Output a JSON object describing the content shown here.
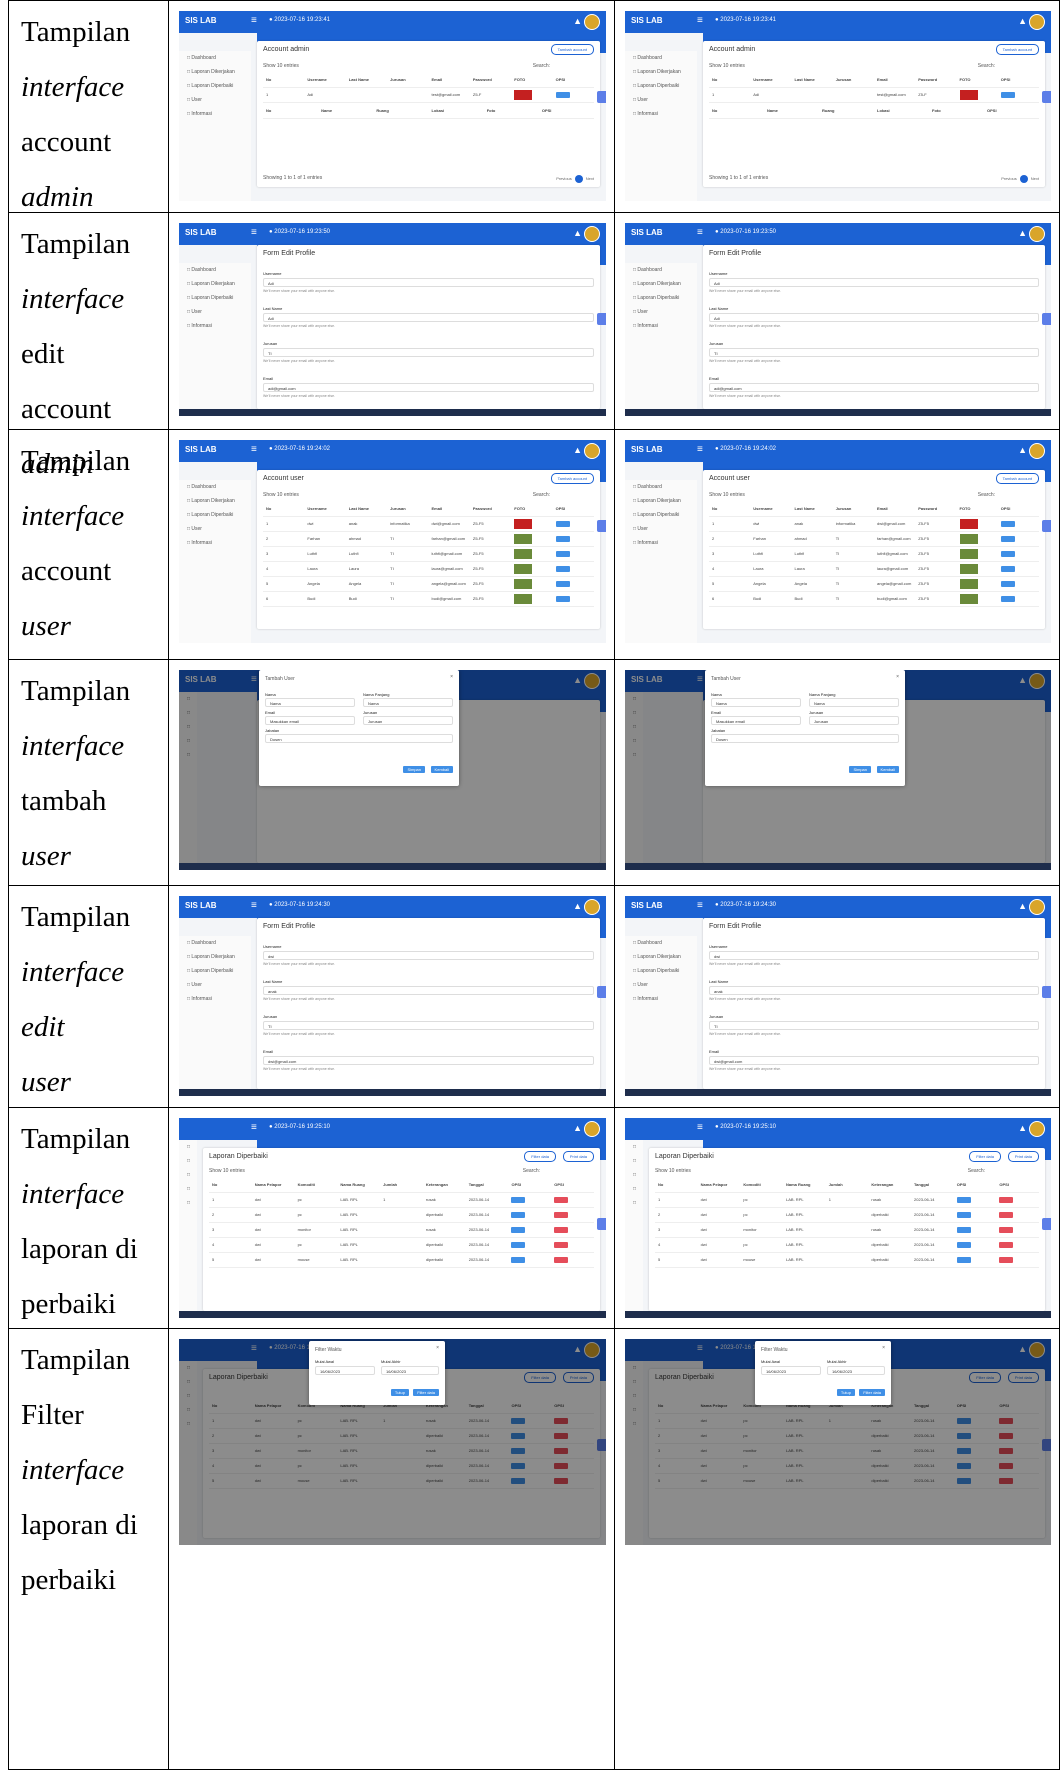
{
  "rows": [
    {
      "label_lines": [
        {
          "text": "Tampilan",
          "italic": false
        },
        {
          "text": "interface",
          "italic": true
        },
        {
          "text": "account",
          "italic": false
        },
        {
          "text": "admin",
          "italic": true
        }
      ],
      "screen": {
        "kind": "table",
        "brand": "SIS LAB",
        "datetime": "2023-07-16 19:23:41",
        "sidebar": [
          "Dashboard",
          "Laporan Dikerjakan",
          "Laporan Diperbaiki",
          "User",
          "Informasi"
        ],
        "title": "Account admin",
        "button": "Tambah account",
        "show": "Show  10  entries",
        "search": "Search:",
        "headers": [
          "No",
          "Username",
          "Last Name",
          "Jurusan",
          "Email",
          "Password",
          "FOTO",
          "OPSI"
        ],
        "rows": [
          [
            "1",
            "Adi",
            "",
            "",
            "test@gmail.com",
            "Z5-F",
            "",
            ""
          ]
        ],
        "footer": [
          "No",
          "Name",
          "Ruang",
          "Lokasi",
          "Foto",
          "OPSI"
        ],
        "info": "Showing 1 to 1 of 1 entries",
        "prev": "Previous",
        "page": "1",
        "next": "Next"
      }
    },
    {
      "label_lines": [
        {
          "text": "Tampilan",
          "italic": false
        },
        {
          "text": "interface",
          "italic": true
        },
        {
          "text": "edit",
          "italic": false
        },
        {
          "text": "account",
          "italic": false
        },
        {
          "text": "admin",
          "italic": true
        }
      ],
      "screen": {
        "kind": "form",
        "brand": "SIS LAB",
        "datetime": "2023-07-16 19:23:50",
        "sidebar": [
          "Dashboard",
          "Laporan Dikerjakan",
          "Laporan Diperbaiki",
          "User",
          "Informasi"
        ],
        "title": "Form Edit Profile",
        "fields": [
          {
            "label": "Username",
            "value": "Adi",
            "help": "We'll never share your email with anyone else."
          },
          {
            "label": "Last Name",
            "value": "Adi",
            "help": "We'll never share your email with anyone else."
          },
          {
            "label": "Jurusan",
            "value": "TI",
            "help": "We'll never share your email with anyone else."
          },
          {
            "label": "Email",
            "value": "adi@gmail.com",
            "help": "We'll never share your email with anyone else."
          }
        ]
      }
    },
    {
      "label_lines": [
        {
          "text": "Tampilan",
          "italic": false
        },
        {
          "text": "interface",
          "italic": true
        },
        {
          "text": "account",
          "italic": false
        },
        {
          "text": "user",
          "italic": true
        }
      ],
      "screen": {
        "kind": "table",
        "brand": "SIS LAB",
        "datetime": "2023-07-16 19:24:02",
        "sidebar": [
          "Dashboard",
          "Laporan Dikerjakan",
          "Laporan Diperbaiki",
          "User",
          "Informasi"
        ],
        "title": "Account user",
        "button": "Tambah account",
        "show": "Show  10  entries",
        "search": "Search:",
        "headers": [
          "No",
          "Username",
          "Last Name",
          "Jurusan",
          "Email",
          "Password",
          "FOTO",
          "OPSI"
        ],
        "rows": [
          [
            "1",
            "dwi",
            "anak",
            "informatika",
            "dwi@gmail.com",
            "Z5-F5",
            "",
            ""
          ],
          [
            "2",
            "Farhan",
            "ahmad",
            "TI",
            "farhan@gmail.com",
            "Z5-F5",
            "",
            ""
          ],
          [
            "3",
            "Luthfi",
            "Luthfi",
            "TI",
            "luthfi@gmail.com",
            "Z5-F5",
            "",
            ""
          ],
          [
            "4",
            "Laura",
            "Laura",
            "TI",
            "laura@gmail.com",
            "Z5-F5",
            "",
            ""
          ],
          [
            "5",
            "Angela",
            "Angela",
            "TI",
            "angela@gmail.com",
            "Z5-F5",
            "",
            ""
          ],
          [
            "6",
            "Budi",
            "Budi",
            "TI",
            "budi@gmail.com",
            "Z5-F5",
            "",
            ""
          ]
        ]
      }
    },
    {
      "label_lines": [
        {
          "text": "Tampilan",
          "italic": false
        },
        {
          "text": "interface",
          "italic": true
        },
        {
          "text": "tambah",
          "italic": false
        },
        {
          "text": "user",
          "italic": true
        }
      ],
      "screen": {
        "kind": "modal_user",
        "brand": "SIS LAB",
        "modal_title": "Tambah User",
        "labels": [
          "Nama",
          "Nama Panjang",
          "Email",
          "Jurusan",
          "Jabatan"
        ],
        "values": [
          "Nama",
          "Nama",
          "Masukkan email",
          "Jurusan",
          "Dosen"
        ],
        "save": "Simpan",
        "cancel": "Kembali"
      }
    },
    {
      "label_lines": [
        {
          "text": "Tampilan",
          "italic": false
        },
        {
          "text": "interface",
          "italic": true
        },
        {
          "text": "edit",
          "italic": true
        },
        {
          "text": "user",
          "italic": true
        }
      ],
      "screen": {
        "kind": "form",
        "brand": "SIS LAB",
        "datetime": "2023-07-16 19:24:30",
        "sidebar": [
          "Dashboard",
          "Laporan Dikerjakan",
          "Laporan Diperbaiki",
          "User",
          "Informasi"
        ],
        "title": "Form Edit Profile",
        "fields": [
          {
            "label": "Username",
            "value": "dwi",
            "help": "We'll never share your email with anyone else."
          },
          {
            "label": "Last Name",
            "value": "anak",
            "help": "We'll never share your email with anyone else."
          },
          {
            "label": "Jurusan",
            "value": "TI",
            "help": "We'll never share your email with anyone else."
          },
          {
            "label": "Email",
            "value": "dwi@gmail.com",
            "help": "We'll never share your email with anyone else."
          }
        ]
      }
    },
    {
      "label_lines": [
        {
          "text": "Tampilan",
          "italic": false
        },
        {
          "text": "interface",
          "italic": true
        },
        {
          "text": "laporan di",
          "italic": false
        },
        {
          "text": "perbaiki",
          "italic": false
        }
      ],
      "screen": {
        "kind": "report",
        "datetime": "2023-07-16 19:25:10",
        "title": "Laporan Diperbaiki",
        "buttons": [
          "Filter data",
          "Print data"
        ],
        "show": "Show  10  entries",
        "search": "Search:",
        "headers": [
          "No",
          "Nama Pelapor",
          "Komoditi",
          "Nama Ruang",
          "Jumlah",
          "Keterangan",
          "Tanggal",
          "OPSI",
          "OPSI"
        ],
        "rows": [
          [
            "1",
            "dwi",
            "pc",
            "LAB. RPL",
            "1",
            "rusak",
            "2023-06-14",
            "",
            ""
          ],
          [
            "2",
            "dwi",
            "pc",
            "LAB. RPL",
            "",
            "diperbaiki",
            "2023-06-14",
            "",
            ""
          ],
          [
            "3",
            "dwi",
            "monitor",
            "LAB. RPL",
            "",
            "rusak",
            "2023-06-14",
            "",
            ""
          ],
          [
            "4",
            "dwi",
            "pc",
            "LAB. RPL",
            "",
            "diperbaiki",
            "2023-06-14",
            "",
            ""
          ],
          [
            "5",
            "dwi",
            "mouse",
            "LAB. RPL",
            "",
            "diperbaiki",
            "2023-06-14",
            "",
            ""
          ]
        ]
      }
    },
    {
      "label_lines": [
        {
          "text": "Tampilan",
          "italic": false
        },
        {
          "text": "Filter",
          "italic": false
        },
        {
          "text": "interface",
          "italic": true
        },
        {
          "text": "laporan di",
          "italic": false
        },
        {
          "text": "perbaiki",
          "italic": false
        }
      ],
      "screen": {
        "kind": "report_filter",
        "datetime": "2023-07-16 19:25:20",
        "title": "Laporan Diperbaiki",
        "buttons": [
          "Filter data",
          "Print data"
        ],
        "modal_title": "Filter Waktu",
        "from_label": "Mulai Awal",
        "to_label": "Mulai Akhir",
        "from_value": "16/06/2023",
        "to_value": "16/06/2023",
        "close": "Tutup",
        "filter": "Filter data",
        "headers": [
          "No",
          "Nama Pelapor",
          "Komoditi",
          "Nama Ruang",
          "Jumlah",
          "Keterangan",
          "Tanggal",
          "OPSI",
          "OPSI"
        ],
        "rows": [
          [
            "1",
            "dwi",
            "pc",
            "LAB. RPL",
            "1",
            "rusak",
            "2023-06-14",
            "",
            ""
          ],
          [
            "2",
            "dwi",
            "pc",
            "LAB. RPL",
            "",
            "diperbaiki",
            "2023-06-14",
            "",
            ""
          ],
          [
            "3",
            "dwi",
            "monitor",
            "LAB. RPL",
            "",
            "rusak",
            "2023-06-14",
            "",
            ""
          ],
          [
            "4",
            "dwi",
            "pc",
            "LAB. RPL",
            "",
            "diperbaiki",
            "2023-06-14",
            "",
            ""
          ],
          [
            "5",
            "dwi",
            "mouse",
            "LAB. RPL",
            "",
            "diperbaiki",
            "2023-06-14",
            "",
            ""
          ]
        ]
      }
    }
  ],
  "colors": {
    "primary": "#1c62d3",
    "pill_blue": "#3f8fe6",
    "pill_red": "#e54d5a"
  }
}
